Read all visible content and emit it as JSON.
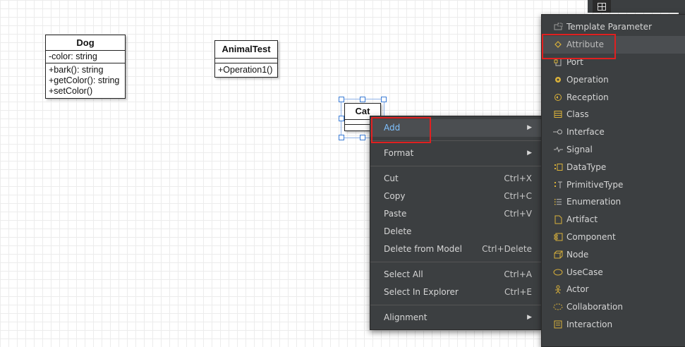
{
  "diagram": {
    "dog": {
      "name": "Dog",
      "attributes": [
        "-color: string"
      ],
      "operations": [
        "+bark(): string",
        "+getColor(): string",
        "+setColor()"
      ]
    },
    "animal_test": {
      "name": "AnimalTest",
      "operations": [
        "+Operation1()"
      ]
    },
    "cat": {
      "name": "Cat"
    }
  },
  "context_menu": {
    "add": "Add",
    "format": "Format",
    "cut": {
      "label": "Cut",
      "shortcut": "Ctrl+X"
    },
    "copy": {
      "label": "Copy",
      "shortcut": "Ctrl+C"
    },
    "paste": {
      "label": "Paste",
      "shortcut": "Ctrl+V"
    },
    "delete": {
      "label": "Delete"
    },
    "delete_from_model": {
      "label": "Delete from Model",
      "shortcut": "Ctrl+Delete"
    },
    "select_all": {
      "label": "Select All",
      "shortcut": "Ctrl+A"
    },
    "select_in_explorer": {
      "label": "Select In Explorer",
      "shortcut": "Ctrl+E"
    },
    "alignment": "Alignment"
  },
  "add_submenu": {
    "items": [
      {
        "label": "Template Parameter",
        "icon": "template-parameter-icon"
      },
      {
        "label": "Attribute",
        "icon": "attribute-icon"
      },
      {
        "label": "Port",
        "icon": "port-icon"
      },
      {
        "label": "Operation",
        "icon": "operation-icon"
      },
      {
        "label": "Reception",
        "icon": "reception-icon"
      },
      {
        "label": "Class",
        "icon": "class-icon"
      },
      {
        "label": "Interface",
        "icon": "interface-icon"
      },
      {
        "label": "Signal",
        "icon": "signal-icon"
      },
      {
        "label": "DataType",
        "icon": "datatype-icon"
      },
      {
        "label": "PrimitiveType",
        "icon": "primitivetype-icon"
      },
      {
        "label": "Enumeration",
        "icon": "enumeration-icon"
      },
      {
        "label": "Artifact",
        "icon": "artifact-icon"
      },
      {
        "label": "Component",
        "icon": "component-icon"
      },
      {
        "label": "Node",
        "icon": "node-icon"
      },
      {
        "label": "UseCase",
        "icon": "usecase-icon"
      },
      {
        "label": "Actor",
        "icon": "actor-icon"
      },
      {
        "label": "Collaboration",
        "icon": "collaboration-icon"
      },
      {
        "label": "Interaction",
        "icon": "interaction-icon"
      }
    ]
  },
  "colors": {
    "menu_bg": "#3c3f41",
    "menu_text": "#d6d6d6",
    "active_text": "#7fc2ff",
    "icon_accent": "#d9b13a",
    "highlight_box": "#e02020",
    "selection": "#3a7bd5"
  }
}
